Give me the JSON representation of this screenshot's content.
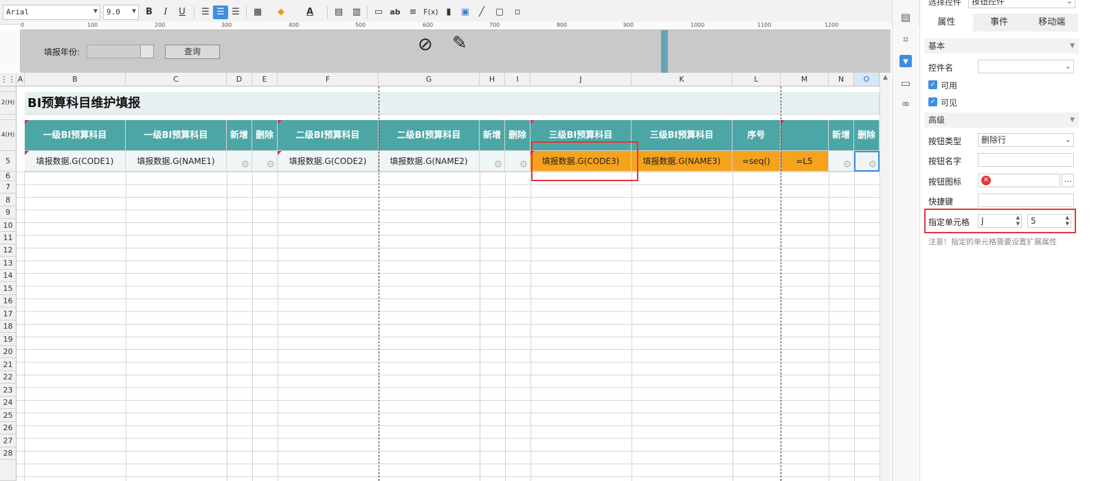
{
  "toolbar": {
    "font_name": "Arial",
    "font_size": "9.0",
    "bold": "B",
    "italic": "I",
    "underline": "U",
    "text_tool": "ab",
    "formula_tool": "F(x)"
  },
  "ruler": {
    "ticks": [
      "0",
      "100",
      "200",
      "300",
      "400",
      "500",
      "600",
      "700",
      "800",
      "900",
      "1000",
      "1100",
      "1200"
    ]
  },
  "param_band": {
    "label": "填报年份:",
    "query_button": "查询"
  },
  "columns": [
    {
      "id": "A",
      "selected": false
    },
    {
      "id": "B",
      "selected": false
    },
    {
      "id": "C",
      "selected": false
    },
    {
      "id": "D",
      "selected": false
    },
    {
      "id": "E",
      "selected": false
    },
    {
      "id": "F",
      "selected": false
    },
    {
      "id": "G",
      "selected": false
    },
    {
      "id": "H",
      "selected": false
    },
    {
      "id": "I",
      "selected": false
    },
    {
      "id": "J",
      "selected": false
    },
    {
      "id": "K",
      "selected": false
    },
    {
      "id": "L",
      "selected": false
    },
    {
      "id": "M",
      "selected": false
    },
    {
      "id": "N",
      "selected": false
    },
    {
      "id": "O",
      "selected": true
    }
  ],
  "rows": [
    "2(H)",
    "4(H)",
    "5",
    "6",
    "7",
    "8",
    "9",
    "10",
    "11",
    "12",
    "13",
    "14",
    "15",
    "16",
    "17",
    "18",
    "19",
    "20",
    "21",
    "22",
    "23",
    "24",
    "25",
    "26",
    "27",
    "28"
  ],
  "sheet": {
    "title": "BI预算科目维护填报",
    "headers": [
      "一级BI预算科目",
      "一级BI预算科目",
      "新增",
      "删除",
      "二级BI预算科目",
      "二级BI预算科目",
      "新增",
      "删除",
      "三级BI预算科目",
      "三级BI预算科目",
      "序号",
      "",
      "新增",
      "删除"
    ],
    "data": [
      "填报数据.G(CODE1)",
      "填报数据.G(NAME1)",
      "",
      "",
      "填报数据.G(CODE2)",
      "填报数据.G(NAME2)",
      "",
      "",
      "填报数据.G(CODE3)",
      "填报数据.G(NAME3)",
      "=seq()",
      "=L5",
      "",
      ""
    ]
  },
  "panel": {
    "select_label": "选择控件",
    "select_value": "按钮控件",
    "tabs": [
      {
        "label": "属性",
        "active": true
      },
      {
        "label": "事件",
        "active": false
      },
      {
        "label": "移动端",
        "active": false
      }
    ],
    "basic_section": "基本",
    "control_name_label": "控件名",
    "control_name_value": "",
    "enabled_label": "可用",
    "visible_label": "可见",
    "advanced_section": "高级",
    "button_type_label": "按钮类型",
    "button_type_value": "删除行",
    "button_name_label": "按钮名字",
    "button_name_value": "",
    "button_icon_label": "按钮图标",
    "button_icon_more": "…",
    "shortcut_label": "快捷键",
    "shortcut_value": "",
    "target_cell_label": "指定单元格",
    "target_col": "J",
    "target_row": "5",
    "note": "注意！指定的单元格需要设置扩展属性"
  },
  "colors": {
    "accent": "#3f8ee0",
    "header_teal": "#4da6a6",
    "highlight_orange": "#f6a21b",
    "annotation_red": "#e5343a"
  }
}
